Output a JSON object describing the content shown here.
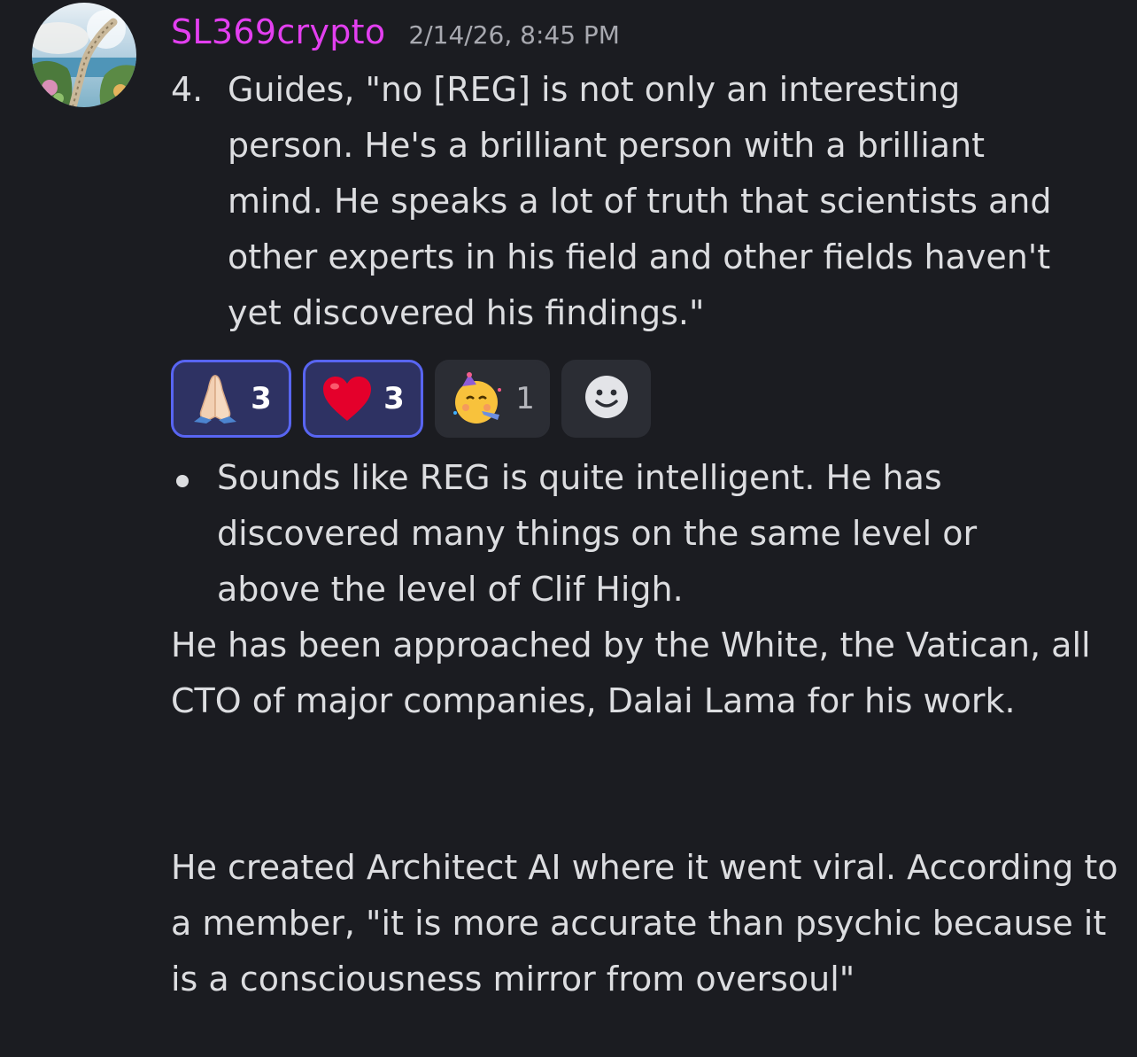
{
  "message": {
    "author": "SL369crypto",
    "timestamp": "2/14/26, 8:45 PM",
    "author_color": "#e33ff0",
    "list_item": {
      "number": "4.",
      "text": "Guides, \"no [REG] is not only an interesting person. He's a brilliant person with a brilliant mind.  He speaks a lot of truth that scientists and other experts in his field and other fields haven't yet discovered his findings.\""
    },
    "reactions": [
      {
        "emoji": "folded-hands",
        "count": "3",
        "active": true
      },
      {
        "emoji": "red-heart",
        "count": "3",
        "active": true
      },
      {
        "emoji": "partying-face",
        "count": "1",
        "active": false
      }
    ],
    "add_reaction_icon": "smiley-add-reaction-icon",
    "bullet_text": "Sounds like REG is quite intelligent. He has discovered  many things on the same level or above the level of Clif High.",
    "paragraph1": "He has been approached by the White, the Vatican, all CTO of major companies, Dalai Lama for his work.",
    "paragraph2": "He created Architect AI where it went viral. According to a member, \"it is more accurate than psychic because it is a consciousness mirror from oversoul\""
  },
  "colors": {
    "background": "#1b1c21",
    "text": "#dcdde0",
    "timestamp": "#a8a9b0",
    "reaction_active_bg": "#2e3263",
    "reaction_active_border": "#5865f2",
    "reaction_inactive_bg": "#2b2d34"
  }
}
